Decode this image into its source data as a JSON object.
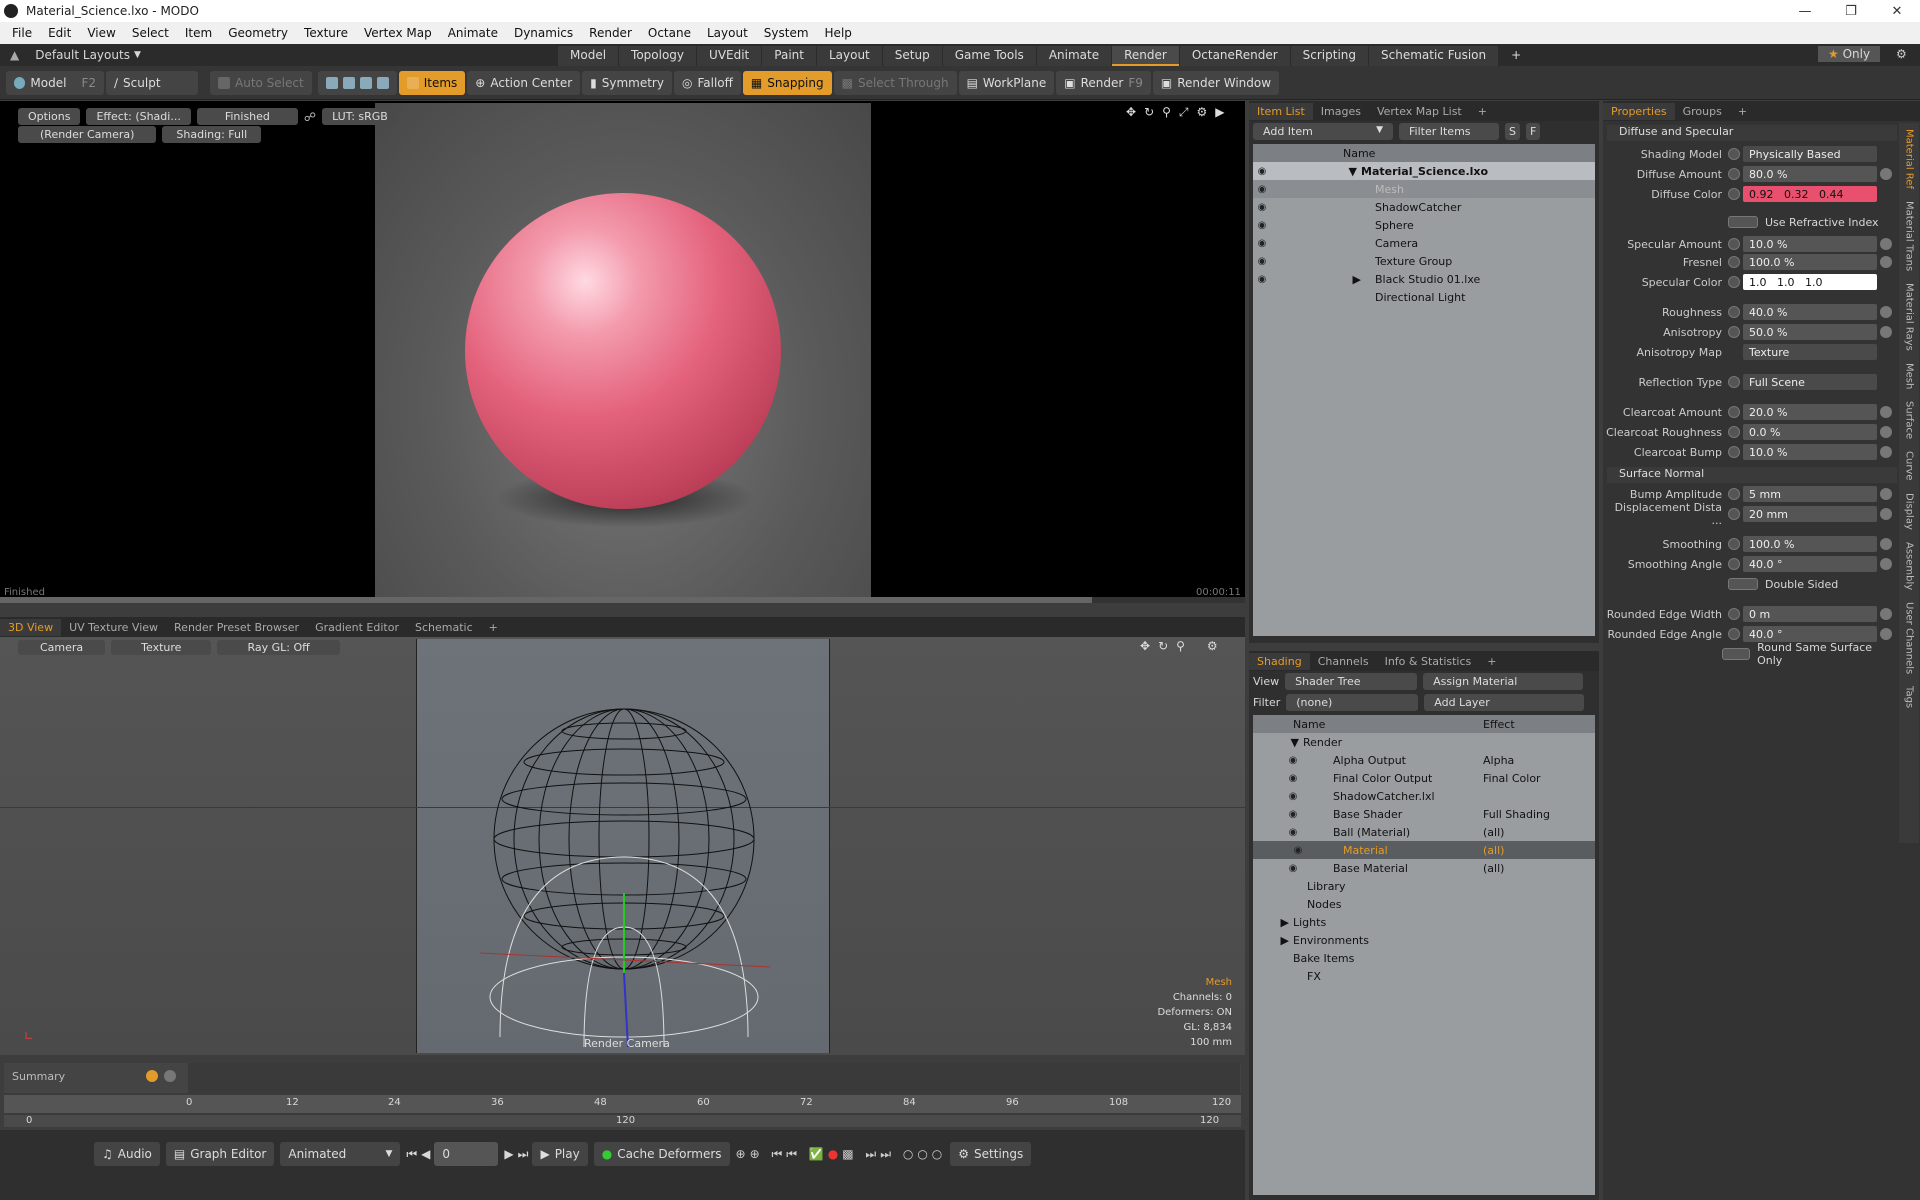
{
  "title": "Material_Science.lxo - MODO",
  "menu": [
    "File",
    "Edit",
    "View",
    "Select",
    "Item",
    "Geometry",
    "Texture",
    "Vertex Map",
    "Animate",
    "Dynamics",
    "Render",
    "Octane",
    "Layout",
    "System",
    "Help"
  ],
  "layout": {
    "name": "Default Layouts",
    "tabs": [
      "Model",
      "Topology",
      "UVEdit",
      "Paint",
      "Layout",
      "Setup",
      "Game Tools",
      "Animate",
      "Render",
      "OctaneRender",
      "Scripting",
      "Schematic Fusion"
    ],
    "active": "Render",
    "only": "Only"
  },
  "toolbar": {
    "model": "Model",
    "model_key": "F2",
    "sculpt": "Sculpt",
    "auto_select": "Auto Select",
    "items": "Items",
    "action_center": "Action Center",
    "symmetry": "Symmetry",
    "falloff": "Falloff",
    "snapping": "Snapping",
    "select_through": "Select Through",
    "workplane": "WorkPlane",
    "render": "Render",
    "render_key": "F9",
    "render_window": "Render Window"
  },
  "render_view": {
    "options": "Options",
    "effect": "Effect: (Shadi...",
    "status": "Finished",
    "lut": "LUT: sRGB",
    "camera": "(Render Camera)",
    "shading": "Shading: Full",
    "footer_left": "Finished",
    "footer_right": "00:00:11"
  },
  "view_tabs": [
    "3D View",
    "UV Texture View",
    "Render Preset Browser",
    "Gradient Editor",
    "Schematic"
  ],
  "view3d": {
    "camera": "Camera",
    "texture": "Texture",
    "raygl": "Ray GL: Off",
    "label": "Render Camera",
    "info": [
      "Mesh",
      "Channels: 0",
      "Deformers: ON",
      "GL: 8,834",
      "100 mm"
    ]
  },
  "timeline": {
    "summary": "Summary",
    "ticks": [
      "0",
      "12",
      "24",
      "36",
      "48",
      "60",
      "72",
      "84",
      "96",
      "108",
      "120"
    ],
    "start": "0",
    "mid": "120",
    "end": "120"
  },
  "bottom": {
    "audio": "Audio",
    "graph_editor": "Graph Editor",
    "animated": "Animated",
    "frame": "0",
    "play": "Play",
    "cache": "Cache Deformers",
    "settings": "Settings"
  },
  "item_list": {
    "tabs": [
      "Item List",
      "Images",
      "Vertex Map List"
    ],
    "add_item": "Add Item",
    "filter": "Filter Items",
    "col_name": "Name",
    "items": [
      {
        "name": "Material_Science.lxo",
        "bold": true
      },
      {
        "name": "Mesh",
        "dim": true
      },
      {
        "name": "ShadowCatcher"
      },
      {
        "name": "Sphere"
      },
      {
        "name": "Camera"
      },
      {
        "name": "Texture Group"
      },
      {
        "name": "Black Studio 01.lxe"
      },
      {
        "name": "Directional Light"
      }
    ]
  },
  "shading": {
    "tabs": [
      "Shading",
      "Channels",
      "Info & Statistics"
    ],
    "view_label": "View",
    "view": "Shader Tree",
    "assign": "Assign Material",
    "filter_label": "Filter",
    "filter": "(none)",
    "add_layer": "Add Layer",
    "col_name": "Name",
    "col_effect": "Effect",
    "rows": [
      {
        "name": "Render",
        "effect": ""
      },
      {
        "name": "Alpha Output",
        "effect": "Alpha"
      },
      {
        "name": "Final Color Output",
        "effect": "Final Color"
      },
      {
        "name": "ShadowCatcher.lxl",
        "effect": ""
      },
      {
        "name": "Base Shader",
        "effect": "Full Shading"
      },
      {
        "name": "Ball (Material)",
        "effect": "(all)"
      },
      {
        "name": "Material",
        "effect": "(all)",
        "selected": true
      },
      {
        "name": "Base Material",
        "effect": "(all)"
      },
      {
        "name": "Library",
        "effect": ""
      },
      {
        "name": "Nodes",
        "effect": ""
      },
      {
        "name": "Lights",
        "effect": ""
      },
      {
        "name": "Environments",
        "effect": ""
      },
      {
        "name": "Bake Items",
        "effect": ""
      },
      {
        "name": "FX",
        "effect": ""
      }
    ]
  },
  "properties": {
    "tabs": [
      "Properties",
      "Groups"
    ],
    "section1": "Diffuse and Specular",
    "section2": "Surface Normal",
    "rows": [
      {
        "label": "Shading Model",
        "value": "Physically Based"
      },
      {
        "label": "Diffuse Amount",
        "value": "80.0 %"
      },
      {
        "label": "Diffuse Color",
        "value": "0.92   0.32   0.44"
      },
      {
        "label": "",
        "value": "Use Refractive Index"
      },
      {
        "label": "Specular Amount",
        "value": "10.0 %"
      },
      {
        "label": "Fresnel",
        "value": "100.0 %"
      },
      {
        "label": "Specular Color",
        "value": "1.0   1.0   1.0"
      },
      {
        "label": "Roughness",
        "value": "40.0 %"
      },
      {
        "label": "Anisotropy",
        "value": "50.0 %"
      },
      {
        "label": "Anisotropy Map",
        "value": "Texture"
      },
      {
        "label": "Reflection Type",
        "value": "Full Scene"
      },
      {
        "label": "Clearcoat Amount",
        "value": "20.0 %"
      },
      {
        "label": "Clearcoat Roughness",
        "value": "0.0 %"
      },
      {
        "label": "Clearcoat Bump",
        "value": "10.0 %"
      },
      {
        "label": "Bump Amplitude",
        "value": "5 mm"
      },
      {
        "label": "Displacement Dista ...",
        "value": "20 mm"
      },
      {
        "label": "Smoothing",
        "value": "100.0 %"
      },
      {
        "label": "Smoothing Angle",
        "value": "40.0 °"
      },
      {
        "label": "",
        "value": "Double Sided"
      },
      {
        "label": "Rounded Edge Width",
        "value": "0 m"
      },
      {
        "label": "Rounded Edge Angle",
        "value": "40.0 °"
      },
      {
        "label": "",
        "value": "Round Same Surface Only"
      }
    ],
    "side_tabs": [
      "Material Ref",
      "Material Trans",
      "Material Rays",
      "Mesh",
      "Surface",
      "Curve",
      "Display",
      "Assembly",
      "User Channels",
      "Tags"
    ]
  },
  "colors": {
    "accent": "#e39b2a",
    "diffuse": "#e8506e",
    "sphere": "#e85b76"
  }
}
